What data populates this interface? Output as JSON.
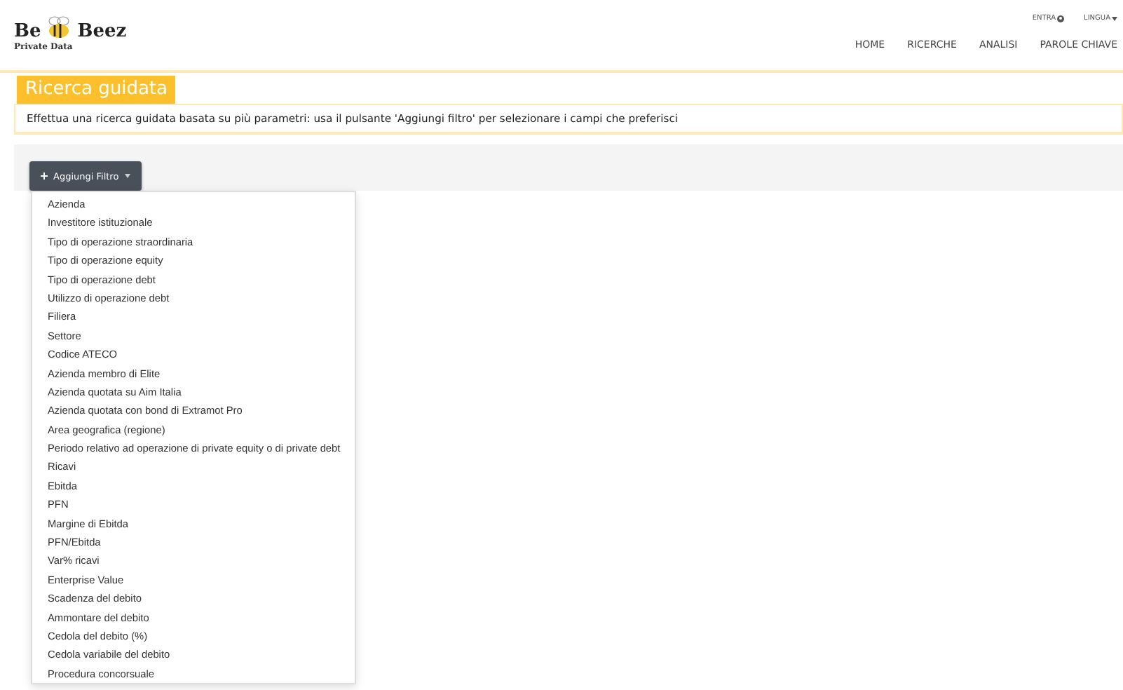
{
  "logo": {
    "word_left": "Be",
    "word_right": "Beez",
    "tagline": "Private Data"
  },
  "top_links": [
    {
      "label": "ENTRA",
      "kind": "login"
    },
    {
      "label": "LINGUA",
      "kind": "dropdown"
    }
  ],
  "nav": [
    "HOME",
    "RICERCHE",
    "ANALISI",
    "PAROLE CHIAVE"
  ],
  "page_title": "Ricerca guidata",
  "description": "Effettua una ricerca guidata basata su più parametri: usa il pulsante 'Aggiungi filtro' per selezionare i campi che preferisci",
  "add_filter": {
    "label": "Aggiungi Filtro",
    "expanded": true
  },
  "filter_menu": [
    "Azienda",
    "Investitore istituzionale",
    "Tipo di operazione straordinaria",
    "Tipo di operazione equity",
    "Tipo di operazione debt",
    "Utilizzo di operazione debt",
    "Filiera",
    "Settore",
    "Codice ATECO",
    "Azienda membro di Elite",
    "Azienda quotata su Aim Italia",
    "Azienda quotata con bond di Extramot Pro",
    "Area geografica (regione)",
    "Periodo relativo ad operazione di private equity o di private debt",
    "Ricavi",
    "Ebitda",
    "PFN",
    "Margine di Ebitda",
    "PFN/Ebitda",
    "Var% ricavi",
    "Enterprise Value",
    "Scadenza del debito",
    "Ammontare del debito",
    "Cedola del debito (%)",
    "Cedola variabile del debito",
    "Procedura concorsuale"
  ]
}
